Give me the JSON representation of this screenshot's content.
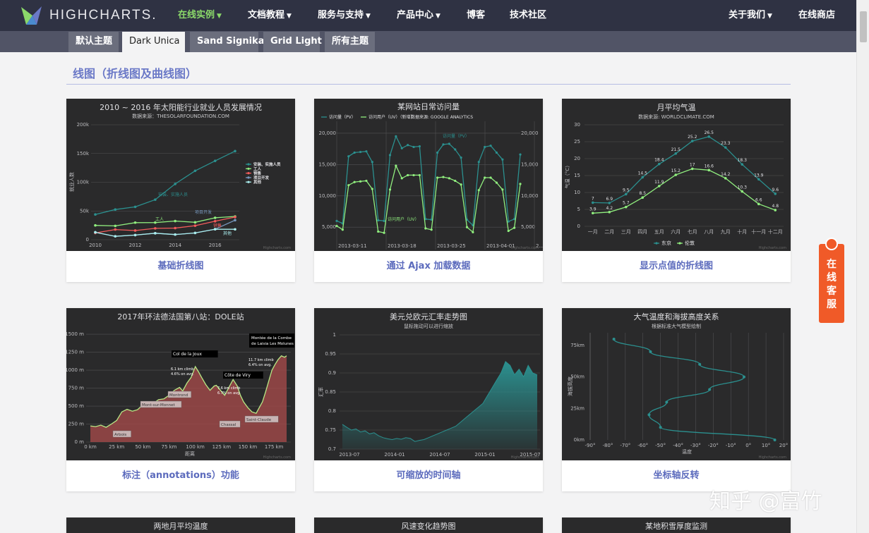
{
  "header": {
    "logo_text": "HIGHCHARTS.",
    "nav": [
      {
        "label": "在线实例",
        "has_caret": true,
        "active": true
      },
      {
        "label": "文档教程",
        "has_caret": true,
        "active": false
      },
      {
        "label": "服务与支持",
        "has_caret": true,
        "active": false
      },
      {
        "label": "产品中心",
        "has_caret": true,
        "active": false
      },
      {
        "label": "博客",
        "has_caret": false,
        "active": false
      },
      {
        "label": "技术社区",
        "has_caret": false,
        "active": false
      }
    ],
    "right_nav": [
      {
        "label": "关于我们",
        "has_caret": true
      },
      {
        "label": "在线商店",
        "has_caret": false
      }
    ],
    "caret_icon": "chevron-down-icon"
  },
  "theme_tabs": {
    "items": [
      "默认主题",
      "Dark Unica",
      "Sand Signika",
      "Grid Light",
      "所有主题"
    ],
    "active": "Dark Unica"
  },
  "section": {
    "title": "线图（折线图及曲线图）"
  },
  "cards": [
    {
      "caption": "基础折线图"
    },
    {
      "caption": "通过 Ajax 加载数据"
    },
    {
      "caption": "显示点值的折线图"
    },
    {
      "caption": "标注（annotations）功能"
    },
    {
      "caption": "可缩放的时间轴"
    },
    {
      "caption": "坐标轴反转"
    },
    {
      "caption": ""
    },
    {
      "caption": ""
    },
    {
      "caption": ""
    }
  ],
  "service_button": {
    "label": "在线客服"
  },
  "watermark": "知乎 @富竹",
  "colors": {
    "nav_bg": "#2f3243",
    "active_nav": "#8bd96a",
    "tab_bar": "#515466",
    "caption": "#5c6bbd",
    "chart_bg": "#2a2a2b",
    "service": "#f05a28"
  },
  "chart_data": [
    {
      "type": "line",
      "title": "2010 ~ 2016 年太阳能行业就业人员发展情况",
      "subtitle": "数据来源：THESOLARFOUNDATION.COM",
      "ylabel": "就业人数",
      "x": [
        2010,
        2011,
        2012,
        2013,
        2014,
        2015,
        2016,
        2017
      ],
      "xticks": [
        "2010",
        "2012",
        "2014",
        "2016"
      ],
      "yticks": [
        "0",
        "50k",
        "100k",
        "150k",
        "200k"
      ],
      "ylim": [
        0,
        200000
      ],
      "series": [
        {
          "name": "安装、实施人员",
          "color": "#2b908f",
          "values": [
            43934,
            52503,
            57177,
            69658,
            97031,
            119931,
            137133,
            154175
          ]
        },
        {
          "name": "工人",
          "color": "#90ee7e",
          "values": [
            24916,
            24064,
            29742,
            29851,
            32490,
            30282,
            38121,
            40434
          ]
        },
        {
          "name": "销售",
          "color": "#f45b5b",
          "values": [
            11744,
            17722,
            16005,
            19771,
            20185,
            24377,
            32147,
            39387
          ]
        },
        {
          "name": "项目开发",
          "color": "#7798bf",
          "values": [
            12908,
            5948,
            8105,
            11248,
            8989,
            11816,
            18274,
            34000
          ]
        },
        {
          "name": "其他",
          "color": "#aaeeee",
          "values": [
            12908,
            5948,
            8105,
            11248,
            8989,
            11816,
            18274,
            18111
          ]
        }
      ],
      "annotations": [
        {
          "text": "安装、实施人员",
          "color": "#2b908f"
        },
        {
          "text": "工人",
          "color": "#90ee7e"
        },
        {
          "text": "项目开发",
          "color": "#7798bf"
        },
        {
          "text": "销售",
          "color": "#f45b5b"
        },
        {
          "text": "其他",
          "color": "#aaeeee"
        }
      ]
    },
    {
      "type": "line",
      "title": "某网站日常访问量",
      "subtitle": "数据来源: GOOGLE ANALYTICS",
      "legend": [
        "访问量（PV）",
        "访问用户（UV）"
      ],
      "xticks": [
        "2013-03-11",
        "2013-03-18",
        "2013-03-25",
        "2013-04-01",
        "2..."
      ],
      "yticks_left": [
        "5,000",
        "10,000",
        "15,000",
        "20,000"
      ],
      "yticks_right": [
        "5,000",
        "10,000",
        "15,000",
        "20,000"
      ],
      "ylim": [
        3000,
        21000
      ],
      "series": [
        {
          "name": "访问量（PV）",
          "color": "#2b908f",
          "values": [
            6000,
            5600,
            16300,
            16900,
            17000,
            17100,
            15400,
            6100,
            6000,
            16500,
            19500,
            17600,
            18100,
            17800,
            17900,
            6300,
            6200,
            16900,
            18200,
            18300,
            17400,
            16100,
            6200,
            5300,
            15400,
            17800,
            18000,
            16900,
            15800,
            5900,
            6300,
            16600
          ]
        },
        {
          "name": "访问用户（UV）",
          "color": "#90ee7e",
          "values": [
            5200,
            4600,
            11700,
            12200,
            12300,
            12400,
            11100,
            4300,
            4100,
            11000,
            14800,
            12800,
            13300,
            13300,
            13300,
            4800,
            4600,
            12900,
            13000,
            12800,
            12400,
            11800,
            5000,
            4200,
            10900,
            12900,
            12900,
            12100,
            11000,
            4400,
            4900,
            11900
          ]
        }
      ],
      "labels": [
        "访问量（PV）",
        "访问用户（UV）"
      ]
    },
    {
      "type": "line",
      "title": "月平均气温",
      "subtitle": "数据来源: WORLDCLIMATE.COM",
      "ylabel": "气温（°C）",
      "categories": [
        "一月",
        "二月",
        "三月",
        "四月",
        "五月",
        "六月",
        "七月",
        "八月",
        "九月",
        "十月",
        "十一月",
        "十二月"
      ],
      "yticks": [
        "0",
        "5",
        "10",
        "15",
        "20",
        "25",
        "30"
      ],
      "ylim": [
        0,
        30
      ],
      "series": [
        {
          "name": "东京",
          "color": "#2b908f",
          "values": [
            7.0,
            6.9,
            9.5,
            14.5,
            18.4,
            21.5,
            25.2,
            26.5,
            23.3,
            18.3,
            13.9,
            9.6
          ]
        },
        {
          "name": "伦敦",
          "color": "#90ee7e",
          "values": [
            3.9,
            4.2,
            5.7,
            8.5,
            11.9,
            15.2,
            17.0,
            16.6,
            14.2,
            10.3,
            6.6,
            4.8
          ]
        }
      ],
      "data_labels": true
    },
    {
      "type": "area",
      "title": "2017年环法德法国第八站：DOLE站",
      "xlabel": "距离",
      "xticks": [
        "0 km",
        "25 km",
        "50 km",
        "75 km",
        "100 km",
        "125 km",
        "150 km",
        "175 km"
      ],
      "yticks": [
        "0 m",
        "250 m",
        "500 m",
        "750 m",
        "1000 m",
        "1250 m",
        "1500 m"
      ],
      "ylim": [
        0,
        1550
      ],
      "xlim": [
        0,
        187
      ],
      "profile": [
        [
          0,
          225
        ],
        [
          5,
          215
        ],
        [
          10,
          235
        ],
        [
          15,
          205
        ],
        [
          20,
          250
        ],
        [
          25,
          300
        ],
        [
          30,
          420
        ],
        [
          35,
          455
        ],
        [
          40,
          430
        ],
        [
          45,
          450
        ],
        [
          50,
          520
        ],
        [
          55,
          560
        ],
        [
          60,
          540
        ],
        [
          65,
          590
        ],
        [
          70,
          600
        ],
        [
          75,
          650
        ],
        [
          80,
          720
        ],
        [
          85,
          760
        ],
        [
          88,
          710
        ],
        [
          92,
          820
        ],
        [
          96,
          900
        ],
        [
          100,
          1050
        ],
        [
          103,
          980
        ],
        [
          106,
          900
        ],
        [
          110,
          800
        ],
        [
          114,
          720
        ],
        [
          118,
          780
        ],
        [
          120,
          790
        ],
        [
          124,
          720
        ],
        [
          128,
          650
        ],
        [
          132,
          760
        ],
        [
          136,
          870
        ],
        [
          140,
          780
        ],
        [
          143,
          650
        ],
        [
          146,
          560
        ],
        [
          150,
          480
        ],
        [
          154,
          420
        ],
        [
          158,
          400
        ],
        [
          161,
          480
        ],
        [
          164,
          560
        ],
        [
          167,
          700
        ],
        [
          170,
          850
        ],
        [
          173,
          1000
        ],
        [
          176,
          1080
        ],
        [
          179,
          1150
        ],
        [
          182,
          1200
        ],
        [
          185,
          1180
        ],
        [
          187,
          1200
        ]
      ],
      "annotations": [
        "Col de la Joux",
        "Côte de Viry",
        "Montée de la Combe de Laisia Les Molunes",
        "Arbois",
        "Montrond",
        "Mont-sur-Monnet",
        "Chassal",
        "Saint-Claude"
      ],
      "climb_notes": [
        "6.1 km climb",
        "4.6% on avg.",
        "7.6 km climb",
        "6.7% on avg.",
        "11.7 km climb",
        "6.4% on avg."
      ]
    },
    {
      "type": "area",
      "title": "美元兑欧元汇率走势图",
      "subtitle": "鼠标拖动可以进行缩放",
      "ylabel": "汇率",
      "xticks": [
        "2013-07",
        "2014-01",
        "2014-07",
        "2015-01",
        "2015-07"
      ],
      "yticks": [
        "0.7",
        "0.75",
        "0.8",
        "0.85",
        "0.9",
        "0.95",
        "1"
      ],
      "ylim": [
        0.7,
        1.0
      ],
      "values": [
        0.765,
        0.757,
        0.75,
        0.753,
        0.745,
        0.748,
        0.74,
        0.743,
        0.735,
        0.73,
        0.727,
        0.725,
        0.728,
        0.726,
        0.73,
        0.728,
        0.72,
        0.723,
        0.725,
        0.73,
        0.735,
        0.74,
        0.745,
        0.75,
        0.755,
        0.76,
        0.77,
        0.78,
        0.79,
        0.8,
        0.81,
        0.82,
        0.84,
        0.86,
        0.88,
        0.9,
        0.93,
        0.92,
        0.895,
        0.91,
        0.89,
        0.92,
        0.9,
        0.895
      ]
    },
    {
      "type": "line",
      "title": "大气温度和海拔高度关系",
      "subtitle": "根据标准大气模型绘制",
      "xlabel": "温度",
      "ylabel": "海拔高度",
      "xticks": [
        "-90°",
        "-80°",
        "-70°",
        "-60°",
        "-50°",
        "-40°",
        "-30°",
        "-20°",
        "-10°",
        "0°",
        "10°",
        "20°"
      ],
      "yticks": [
        "0km",
        "25km",
        "50km",
        "75km"
      ],
      "xlim": [
        -90,
        20
      ],
      "ylim": [
        0,
        85
      ],
      "points": [
        [
          15,
          0
        ],
        [
          -50,
          10
        ],
        [
          -56.5,
          20
        ],
        [
          -46.5,
          30
        ],
        [
          -22.1,
          40
        ],
        [
          -2.5,
          50
        ],
        [
          -27.7,
          60
        ],
        [
          -55.7,
          70
        ],
        [
          -76.5,
          80
        ]
      ]
    }
  ],
  "partial_titles": [
    "两地月平均温度",
    "风速变化趋势图",
    "某地积雪厚度监测"
  ]
}
